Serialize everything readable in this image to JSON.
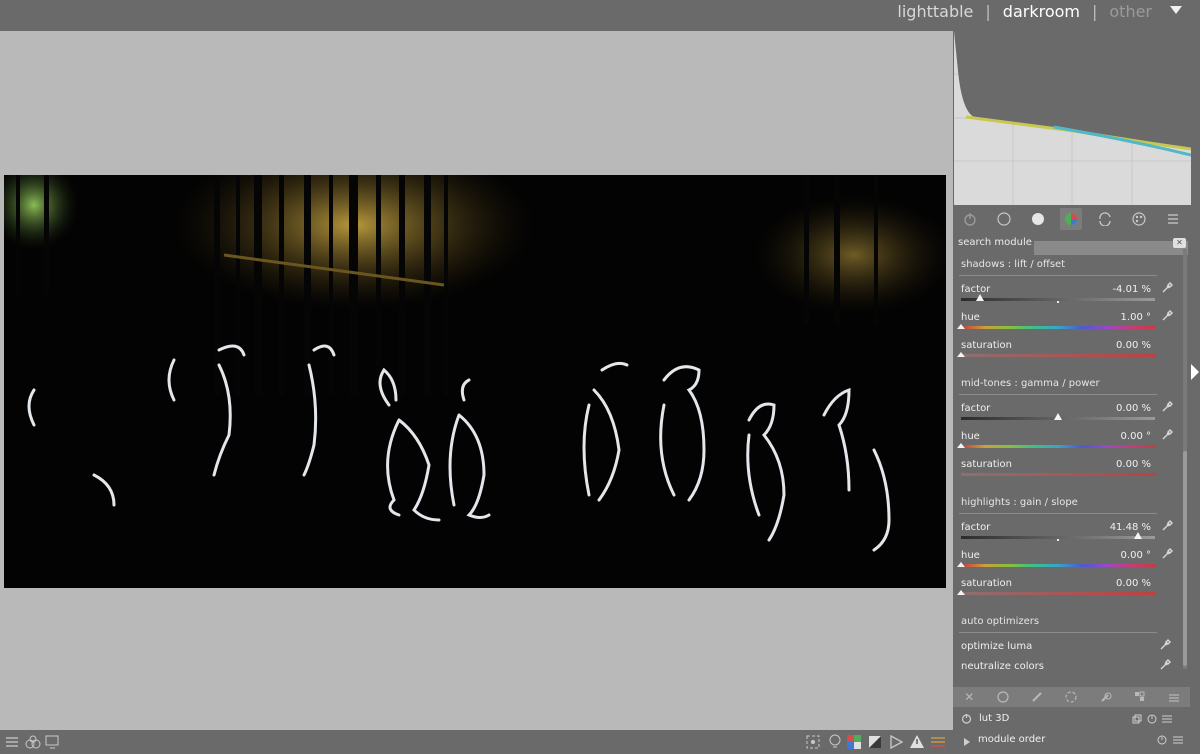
{
  "views": {
    "lighttable": "lighttable",
    "separator1": "|",
    "darkroom": "darkroom",
    "separator2": "|",
    "other": "other"
  },
  "search": {
    "label": "search module",
    "value": ""
  },
  "module": {
    "shadows": {
      "title": "shadows : lift / offset",
      "factor_label": "factor",
      "factor_value": "-4.01 %",
      "hue_label": "hue",
      "hue_value": "1.00 °",
      "saturation_label": "saturation",
      "saturation_value": "0.00 %"
    },
    "midtones": {
      "title": "mid-tones : gamma / power",
      "factor_label": "factor",
      "factor_value": "0.00 %",
      "hue_label": "hue",
      "hue_value": "0.00 °",
      "saturation_label": "saturation",
      "saturation_value": "0.00 %"
    },
    "highlights": {
      "title": "highlights : gain / slope",
      "factor_label": "factor",
      "factor_value": "41.48 %",
      "hue_label": "hue",
      "hue_value": "0.00 °",
      "saturation_label": "saturation",
      "saturation_value": "0.00 %"
    },
    "auto": {
      "title": "auto optimizers",
      "optimize_luma": "optimize luma",
      "neutralize_colors": "neutralize colors"
    }
  },
  "lut": {
    "label": "lut 3D"
  },
  "footer": {
    "module_order": "module order"
  },
  "slider_levels": {
    "shadows_factor": -0.0401,
    "midtones_factor": 0.0,
    "highlights_factor": 0.4148
  }
}
